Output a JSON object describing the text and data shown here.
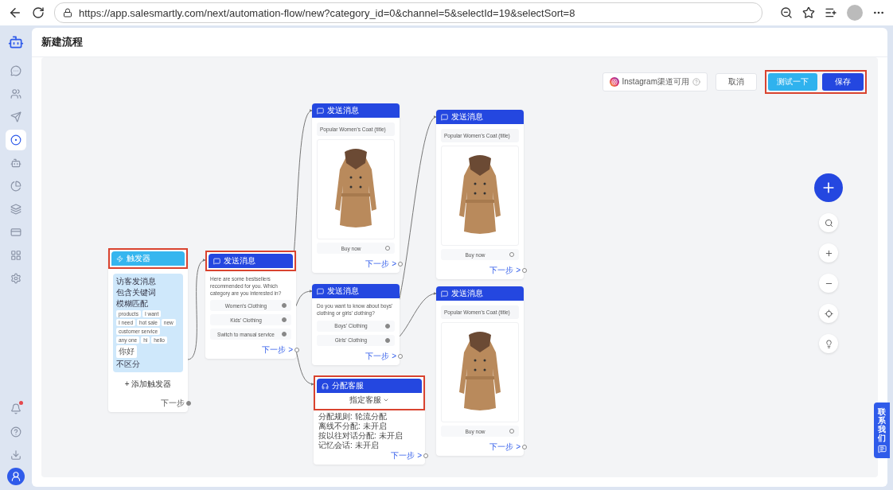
{
  "browser": {
    "url": "https://app.salesmartly.com/next/automation-flow/new?category_id=0&channel=5&selectId=19&selectSort=8"
  },
  "sidebar": {
    "items": [
      {
        "selected": false
      },
      {
        "selected": false
      },
      {
        "selected": false
      },
      {
        "selected": true
      },
      {
        "selected": false
      },
      {
        "selected": false
      },
      {
        "selected": false
      },
      {
        "selected": false
      },
      {
        "selected": false
      },
      {
        "selected": false
      }
    ],
    "bottom": [
      {
        "badge": true
      },
      {
        "badge": false
      },
      {
        "badge": false
      }
    ]
  },
  "page": {
    "title": "新建流程"
  },
  "toolbar": {
    "channel_note": "Instagram渠道可用",
    "highlighted": true,
    "buttons": [
      {
        "label": "取消",
        "kind": "secondary"
      },
      {
        "label": "测试一下",
        "kind": "test"
      },
      {
        "label": "保存",
        "kind": "primary"
      }
    ]
  },
  "nodes": [
    {
      "kind": "trigger",
      "title": "触发器",
      "highlighted": true,
      "event": "访客发消息",
      "rule": "包含关键词",
      "match": "模糊匹配",
      "keywords": [
        "products",
        "I want",
        "I need",
        "hot sale",
        "new",
        "customer service",
        "any one",
        "hi",
        "hello",
        "你好"
      ],
      "case": "不区分",
      "add_label": "+ 添加触发器",
      "next": "下一步"
    },
    {
      "kind": "message",
      "title": "发送消息",
      "highlighted": true,
      "blocks": [
        {
          "kind": "text",
          "text": "Here are some bestsellers recommended for you. Which category are you interested in?"
        },
        {
          "kind": "option",
          "label": "Women's Clothing",
          "connected": true
        },
        {
          "kind": "option",
          "label": "Kids' Clothing",
          "connected": true
        },
        {
          "kind": "option",
          "label": "Switch to manual service",
          "connected": true
        }
      ],
      "next": "下一步 >"
    },
    {
      "kind": "message",
      "title": "发送消息",
      "highlighted": false,
      "blocks": [
        {
          "kind": "field",
          "text": "Popular Women's Coat (title)"
        },
        {
          "kind": "image"
        },
        {
          "kind": "option",
          "label": "Buy now",
          "connected": false
        }
      ],
      "next": "下一步 >"
    },
    {
      "kind": "message",
      "title": "发送消息",
      "highlighted": false,
      "blocks": [
        {
          "kind": "text",
          "text": "Do you want to know about boys' clothing or girls' clothing?"
        },
        {
          "kind": "option",
          "label": "Boys' Clothing",
          "connected": true
        },
        {
          "kind": "option",
          "label": "Girls' Clothing",
          "connected": true
        }
      ],
      "next": "下一步 >"
    },
    {
      "kind": "assign",
      "title": "分配客服",
      "highlighted": true,
      "select": "指定客服",
      "lines": [
        "分配规则: 轮流分配",
        "离线不分配: 未开启",
        "按以往对话分配: 未开启",
        "记忆会话: 未开启"
      ],
      "next": "下一步 >"
    },
    {
      "kind": "message",
      "title": "发送消息",
      "highlighted": false,
      "blocks": [
        {
          "kind": "field",
          "text": "Popular Women's Coat (title)"
        },
        {
          "kind": "image"
        },
        {
          "kind": "option",
          "label": "Buy now",
          "connected": false
        }
      ],
      "next": "下一步 >"
    },
    {
      "kind": "message",
      "title": "发送消息",
      "highlighted": false,
      "blocks": [
        {
          "kind": "field",
          "text": "Popular Women's Coat (title)"
        },
        {
          "kind": "image"
        },
        {
          "kind": "option",
          "label": "Buy now",
          "connected": false
        }
      ],
      "next": "下一步 >"
    }
  ],
  "contact_tab": {
    "label": "联系我们"
  }
}
